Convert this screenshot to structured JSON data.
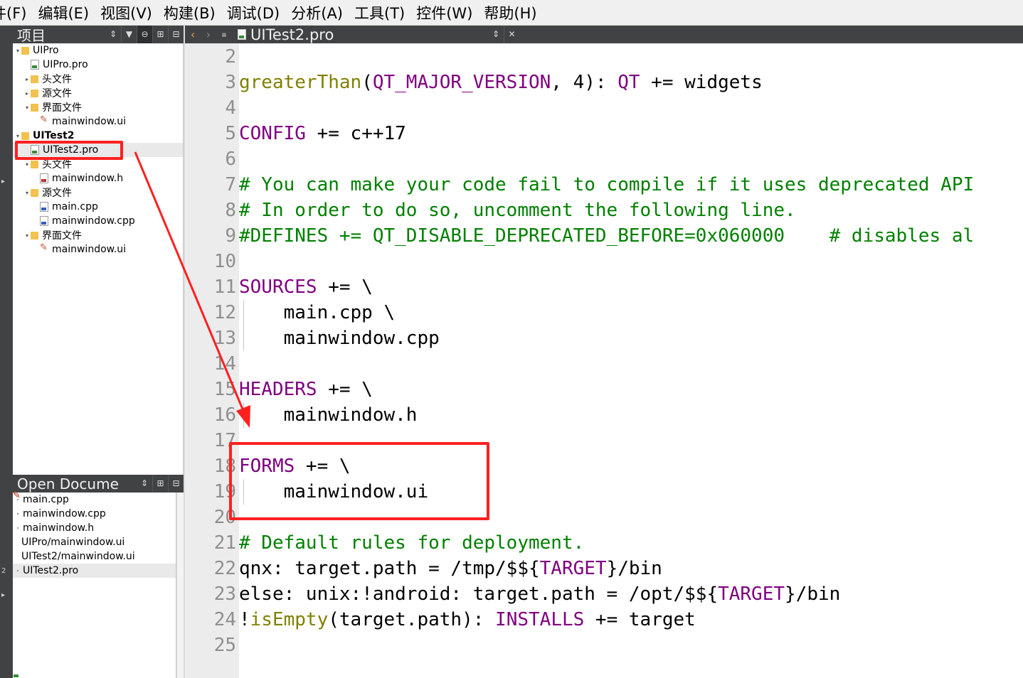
{
  "menubar": {
    "items": [
      "件(F)",
      "编辑(E)",
      "视图(V)",
      "构建(B)",
      "调试(D)",
      "分析(A)",
      "工具(T)",
      "控件(W)",
      "帮助(H)"
    ]
  },
  "project_pane": {
    "title": "项目",
    "tree": [
      {
        "label": "UIPro",
        "kind": "project",
        "expanded": true
      },
      {
        "label": "UIPro.pro",
        "kind": "pro"
      },
      {
        "label": "头文件",
        "kind": "h-folder",
        "expanded": false
      },
      {
        "label": "源文件",
        "kind": "cpp-folder",
        "expanded": false
      },
      {
        "label": "界面文件",
        "kind": "ui-folder",
        "expanded": true
      },
      {
        "label": "mainwindow.ui",
        "kind": "ui"
      },
      {
        "label": "UITest2",
        "kind": "project",
        "expanded": true,
        "bold": true
      },
      {
        "label": "UITest2.pro",
        "kind": "pro",
        "selected": true
      },
      {
        "label": "头文件",
        "kind": "h-folder",
        "expanded": true
      },
      {
        "label": "mainwindow.h",
        "kind": "h"
      },
      {
        "label": "源文件",
        "kind": "cpp-folder",
        "expanded": true
      },
      {
        "label": "main.cpp",
        "kind": "cpp"
      },
      {
        "label": "mainwindow.cpp",
        "kind": "cpp"
      },
      {
        "label": "界面文件",
        "kind": "ui-folder",
        "expanded": true
      },
      {
        "label": "mainwindow.ui",
        "kind": "ui"
      }
    ]
  },
  "open_documents": {
    "title": "Open Docume",
    "items": [
      {
        "label": "main.cpp",
        "kind": "cpp"
      },
      {
        "label": "mainwindow.cpp",
        "kind": "cpp"
      },
      {
        "label": "mainwindow.h",
        "kind": "h"
      },
      {
        "label": "UIPro/mainwindow.ui",
        "kind": "ui"
      },
      {
        "label": "UITest2/mainwindow.ui",
        "kind": "ui"
      },
      {
        "label": "UITest2.pro",
        "kind": "pro",
        "selected": true
      }
    ]
  },
  "editor": {
    "document_title": "UITest2.pro",
    "line_numbers": [
      "2",
      "3",
      "4",
      "5",
      "6",
      "7",
      "8",
      "9",
      "10",
      "11",
      "12",
      "13",
      "14",
      "15",
      "16",
      "17",
      "18",
      "19",
      "20",
      "21",
      "22",
      "23",
      "24",
      "25"
    ],
    "lines": [
      [],
      [
        {
          "t": "greaterThan",
          "c": "fn"
        },
        {
          "t": "(",
          "c": ""
        },
        {
          "t": "QT_MAJOR_VERSION",
          "c": "kw"
        },
        {
          "t": ", 4): ",
          "c": ""
        },
        {
          "t": "QT",
          "c": "kw"
        },
        {
          "t": " += widgets",
          "c": ""
        }
      ],
      [],
      [
        {
          "t": "CONFIG",
          "c": "kw"
        },
        {
          "t": " += c++17",
          "c": ""
        }
      ],
      [],
      [
        {
          "t": "# You can make your code fail to compile if it uses deprecated API",
          "c": "cm"
        }
      ],
      [
        {
          "t": "# In order to do so, uncomment the following line.",
          "c": "cm"
        }
      ],
      [
        {
          "t": "#DEFINES += QT_DISABLE_DEPRECATED_BEFORE=0x060000    # disables al",
          "c": "cm"
        }
      ],
      [],
      [
        {
          "t": "SOURCES",
          "c": "kw"
        },
        {
          "t": " += \\",
          "c": ""
        }
      ],
      [
        {
          "t": "    main.cpp \\",
          "c": ""
        }
      ],
      [
        {
          "t": "    mainwindow.cpp",
          "c": ""
        }
      ],
      [],
      [
        {
          "t": "HEADERS",
          "c": "kw"
        },
        {
          "t": " += \\",
          "c": ""
        }
      ],
      [
        {
          "t": "    mainwindow.h",
          "c": ""
        }
      ],
      [],
      [
        {
          "t": "FORMS",
          "c": "kw"
        },
        {
          "t": " += \\",
          "c": ""
        }
      ],
      [
        {
          "t": "    mainwindow.ui",
          "c": ""
        }
      ],
      [],
      [
        {
          "t": "# Default rules for deployment.",
          "c": "cm"
        }
      ],
      [
        {
          "t": "qnx: target.path = /tmp/$${",
          "c": ""
        },
        {
          "t": "TARGET",
          "c": "kw"
        },
        {
          "t": "}/bin",
          "c": ""
        }
      ],
      [
        {
          "t": "else: unix:!android: target.path = /opt/$${",
          "c": ""
        },
        {
          "t": "TARGET",
          "c": "kw"
        },
        {
          "t": "}/bin",
          "c": ""
        }
      ],
      [
        {
          "t": "!",
          "c": ""
        },
        {
          "t": "isEmpty",
          "c": "fn"
        },
        {
          "t": "(target.path): ",
          "c": ""
        },
        {
          "t": "INSTALLS",
          "c": "kw"
        },
        {
          "t": " += target",
          "c": ""
        }
      ],
      []
    ]
  },
  "colors": {
    "keyword": "#800080",
    "function": "#808000",
    "comment": "#008000",
    "annotation": "#ff2020"
  }
}
